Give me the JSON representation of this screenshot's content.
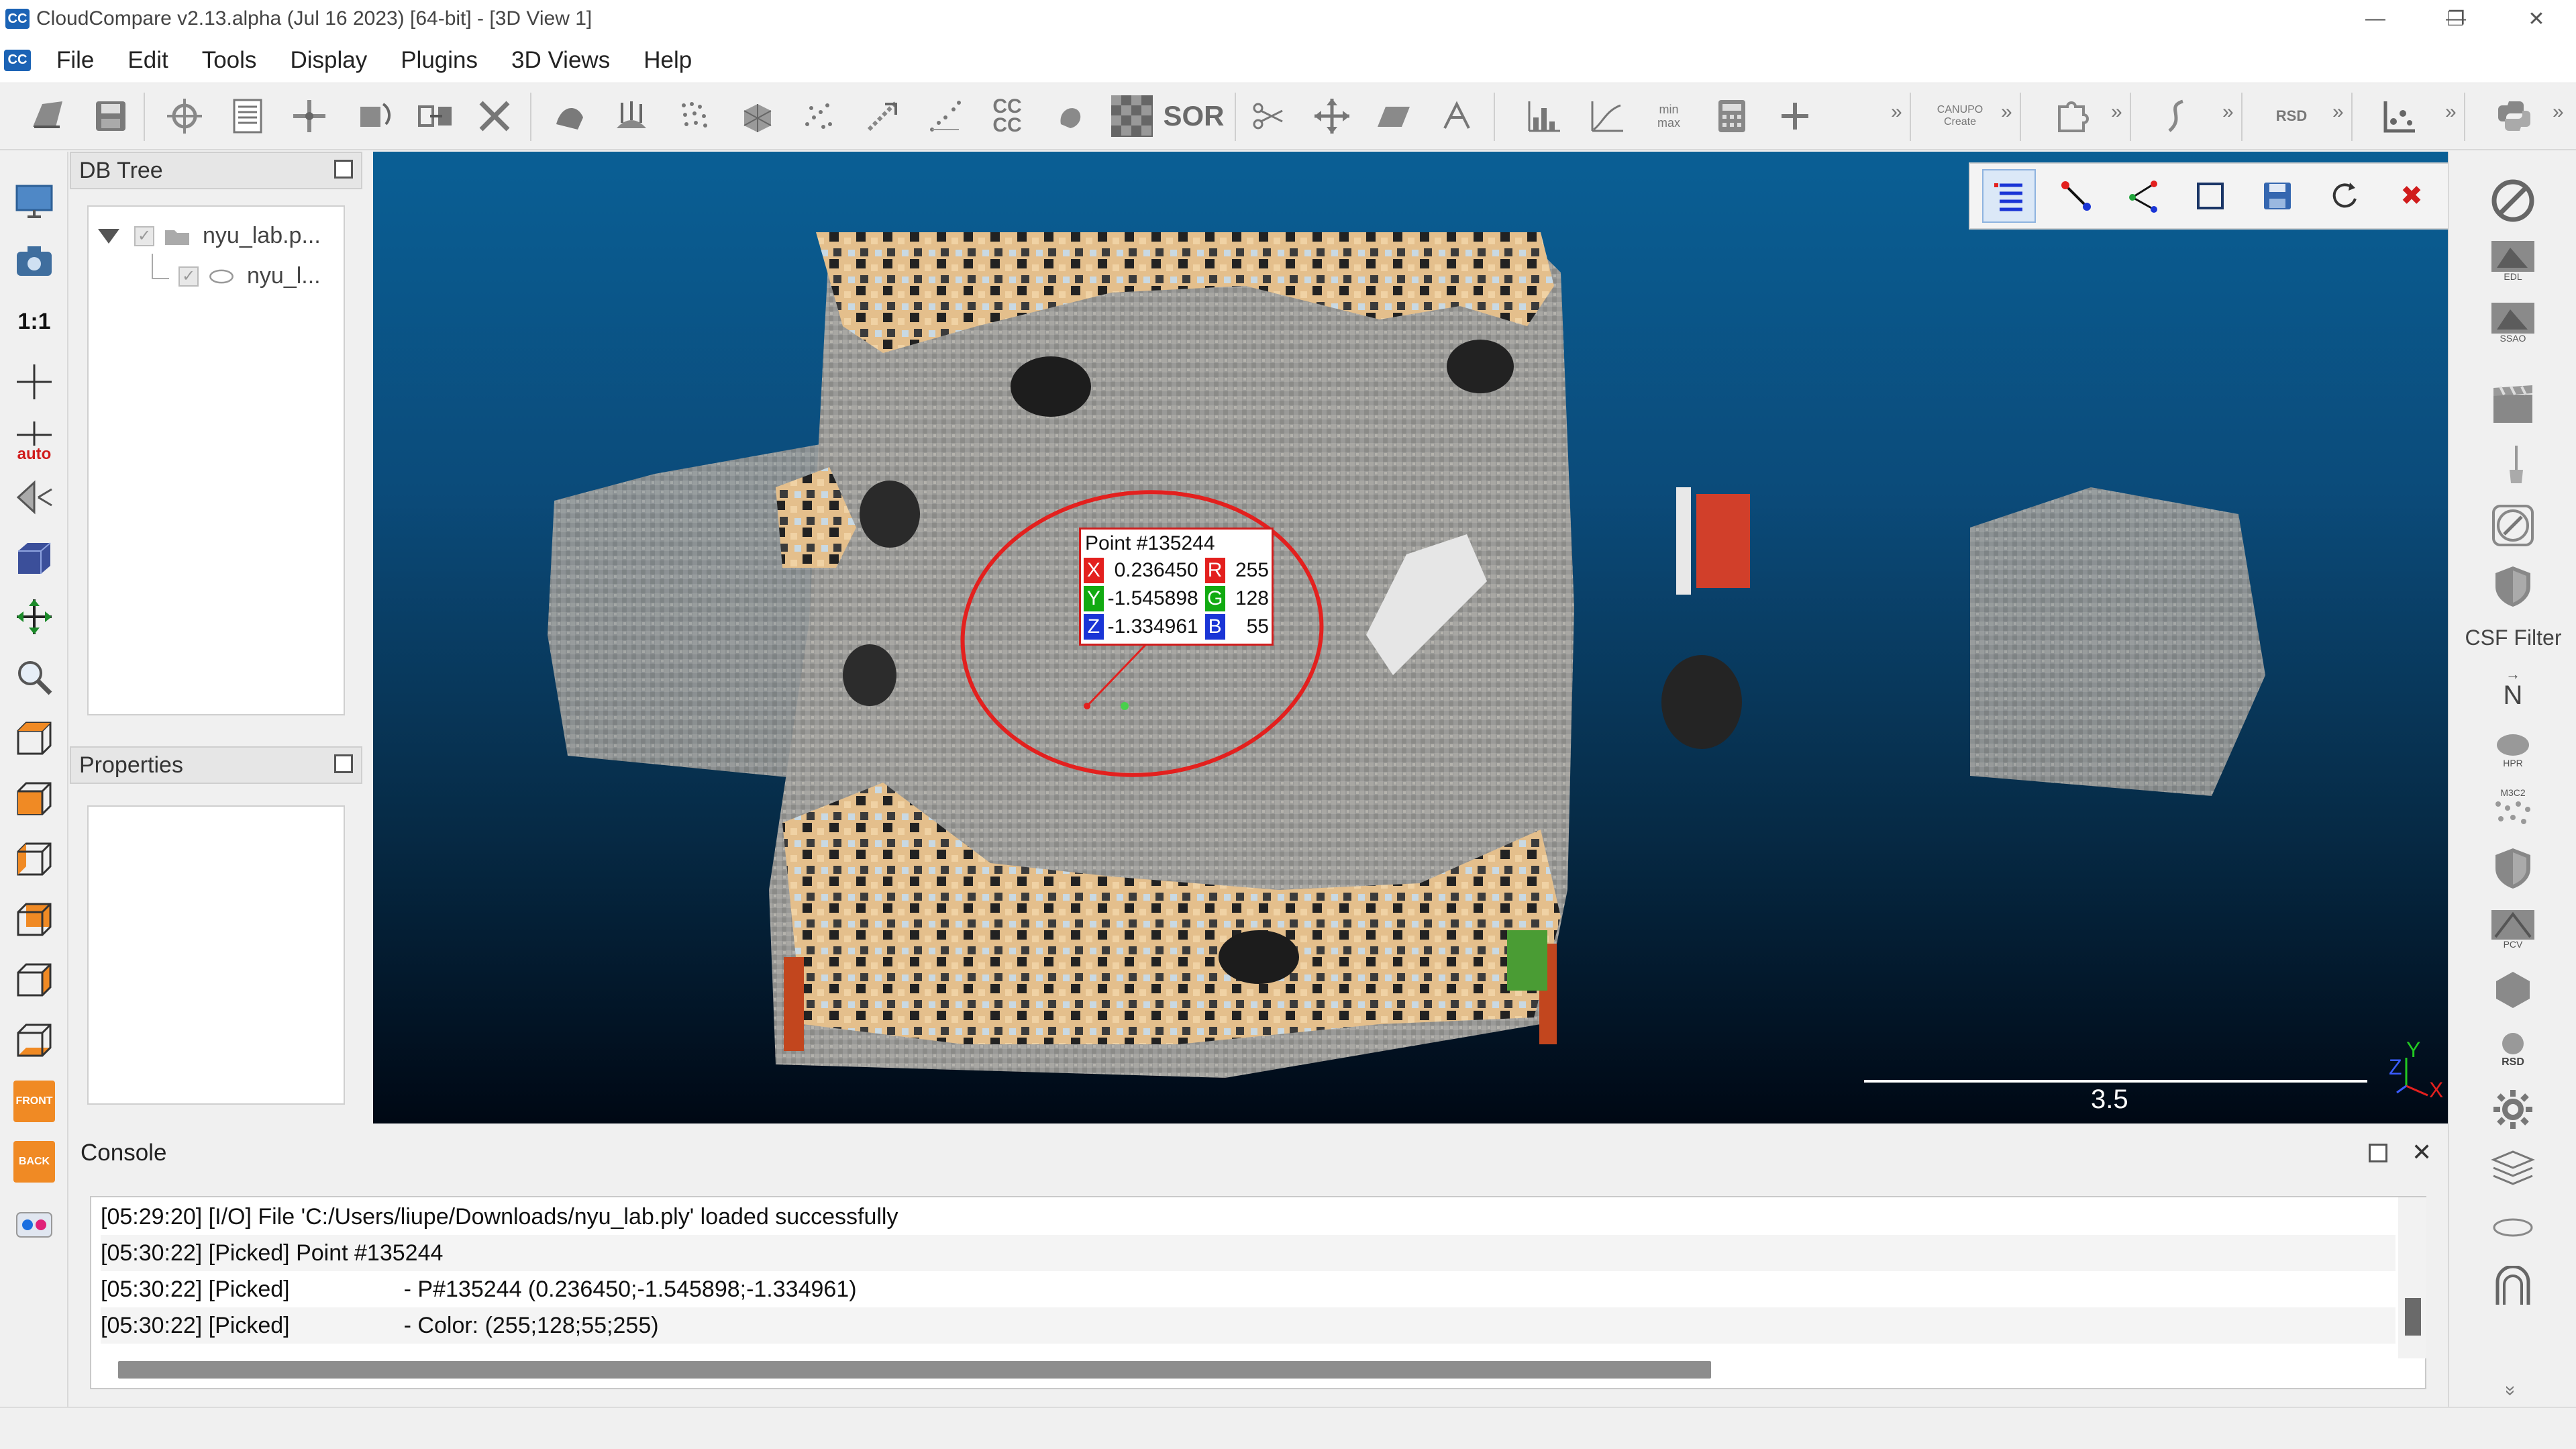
{
  "window": {
    "title": "CloudCompare v2.13.alpha (Jul 16 2023) [64-bit] - [3D View 1]",
    "logo_text": "CC",
    "minimize": "—",
    "maximize": "❐",
    "close": "✕"
  },
  "menu": {
    "items": [
      "File",
      "Edit",
      "Tools",
      "Display",
      "Plugins",
      "3D Views",
      "Help"
    ]
  },
  "toolbar": {
    "icons": [
      "open-icon",
      "save-icon",
      "global-shift-icon",
      "list-icon",
      "translate-icon",
      "rotate-icon",
      "merge-icon",
      "delete-icon",
      "sample-icon",
      "normals-icon",
      "subsample-icon",
      "octree-icon",
      "noise-icon",
      "distance-icon",
      "cloud-compare-icon",
      "cc-label-icon",
      "volume-icon",
      "checker-icon",
      "sor-icon",
      "scissors-icon",
      "move-icon",
      "plane-icon",
      "segment-icon",
      "histogram-icon",
      "graph-icon",
      "minmax-icon",
      "calculator-icon",
      "plus-icon",
      "canupo-icon",
      "puzzle-icon",
      "curve-icon",
      "ransac-icon",
      "cloud-layers-icon",
      "python-icon"
    ],
    "sor_label": "SOR",
    "cccc_label": "CC CC",
    "minmax_label": "min max",
    "canupo_label": "CANUPO Create",
    "ransac_label": "RSD",
    "more": "»"
  },
  "left_tools": {
    "one_to_one": "1:1",
    "auto": "auto",
    "front": "FRONT",
    "back": "BACK"
  },
  "db_tree": {
    "title": "DB Tree",
    "items": [
      {
        "label": "nyu_lab.p...",
        "level": 0
      },
      {
        "label": "nyu_l...",
        "level": 1
      }
    ]
  },
  "properties": {
    "title": "Properties"
  },
  "view": {
    "point_label": {
      "title": "Point #135244",
      "x_axis": "X",
      "x_value": "0.236450",
      "y_axis": "Y",
      "y_value": "-1.545898",
      "z_axis": "Z",
      "z_value": "-1.334961",
      "r_channel": "R",
      "r_value": "255",
      "g_channel": "G",
      "g_value": "128",
      "b_channel": "B",
      "b_value": "55"
    },
    "scale_value": "3.5",
    "axis_x": "X",
    "axis_y": "Y",
    "axis_z": "Z",
    "toolbar_icons": [
      "label-list-icon",
      "point-link-icon",
      "angle-icon",
      "area-icon",
      "save-icon",
      "reset-icon",
      "close-icon"
    ],
    "close_glyph": "✖"
  },
  "right_tools": {
    "csf_label": "CSF Filter",
    "edl_label": "EDL",
    "ssao_label": "SSAO",
    "hpr_label": "HPR",
    "m3c2_label": "M3C2",
    "pcv_label": "PCV",
    "rsd_label": "RSD",
    "north_label": "N",
    "more": "»"
  },
  "console": {
    "title": "Console",
    "lines": [
      {
        "msg": "[05:29:20] [I/O] File 'C:/Users/liupe/Downloads/nyu_lab.ply' loaded successfully"
      },
      {
        "msg": "[05:30:22] [Picked] Point #135244"
      },
      {
        "msg": "[05:30:22] [Picked]                  - P#135244 (0.236450;-1.545898;-1.334961)"
      },
      {
        "msg": "[05:30:22] [Picked]                  - Color: (255;128;55;255)"
      }
    ],
    "close_glyph": "✕"
  },
  "colors": {
    "accent": "#1b63b5",
    "annotation_red": "#e3201e",
    "x_axis": "#e3201e",
    "y_axis": "#11aa11",
    "z_axis": "#1a35d6"
  }
}
